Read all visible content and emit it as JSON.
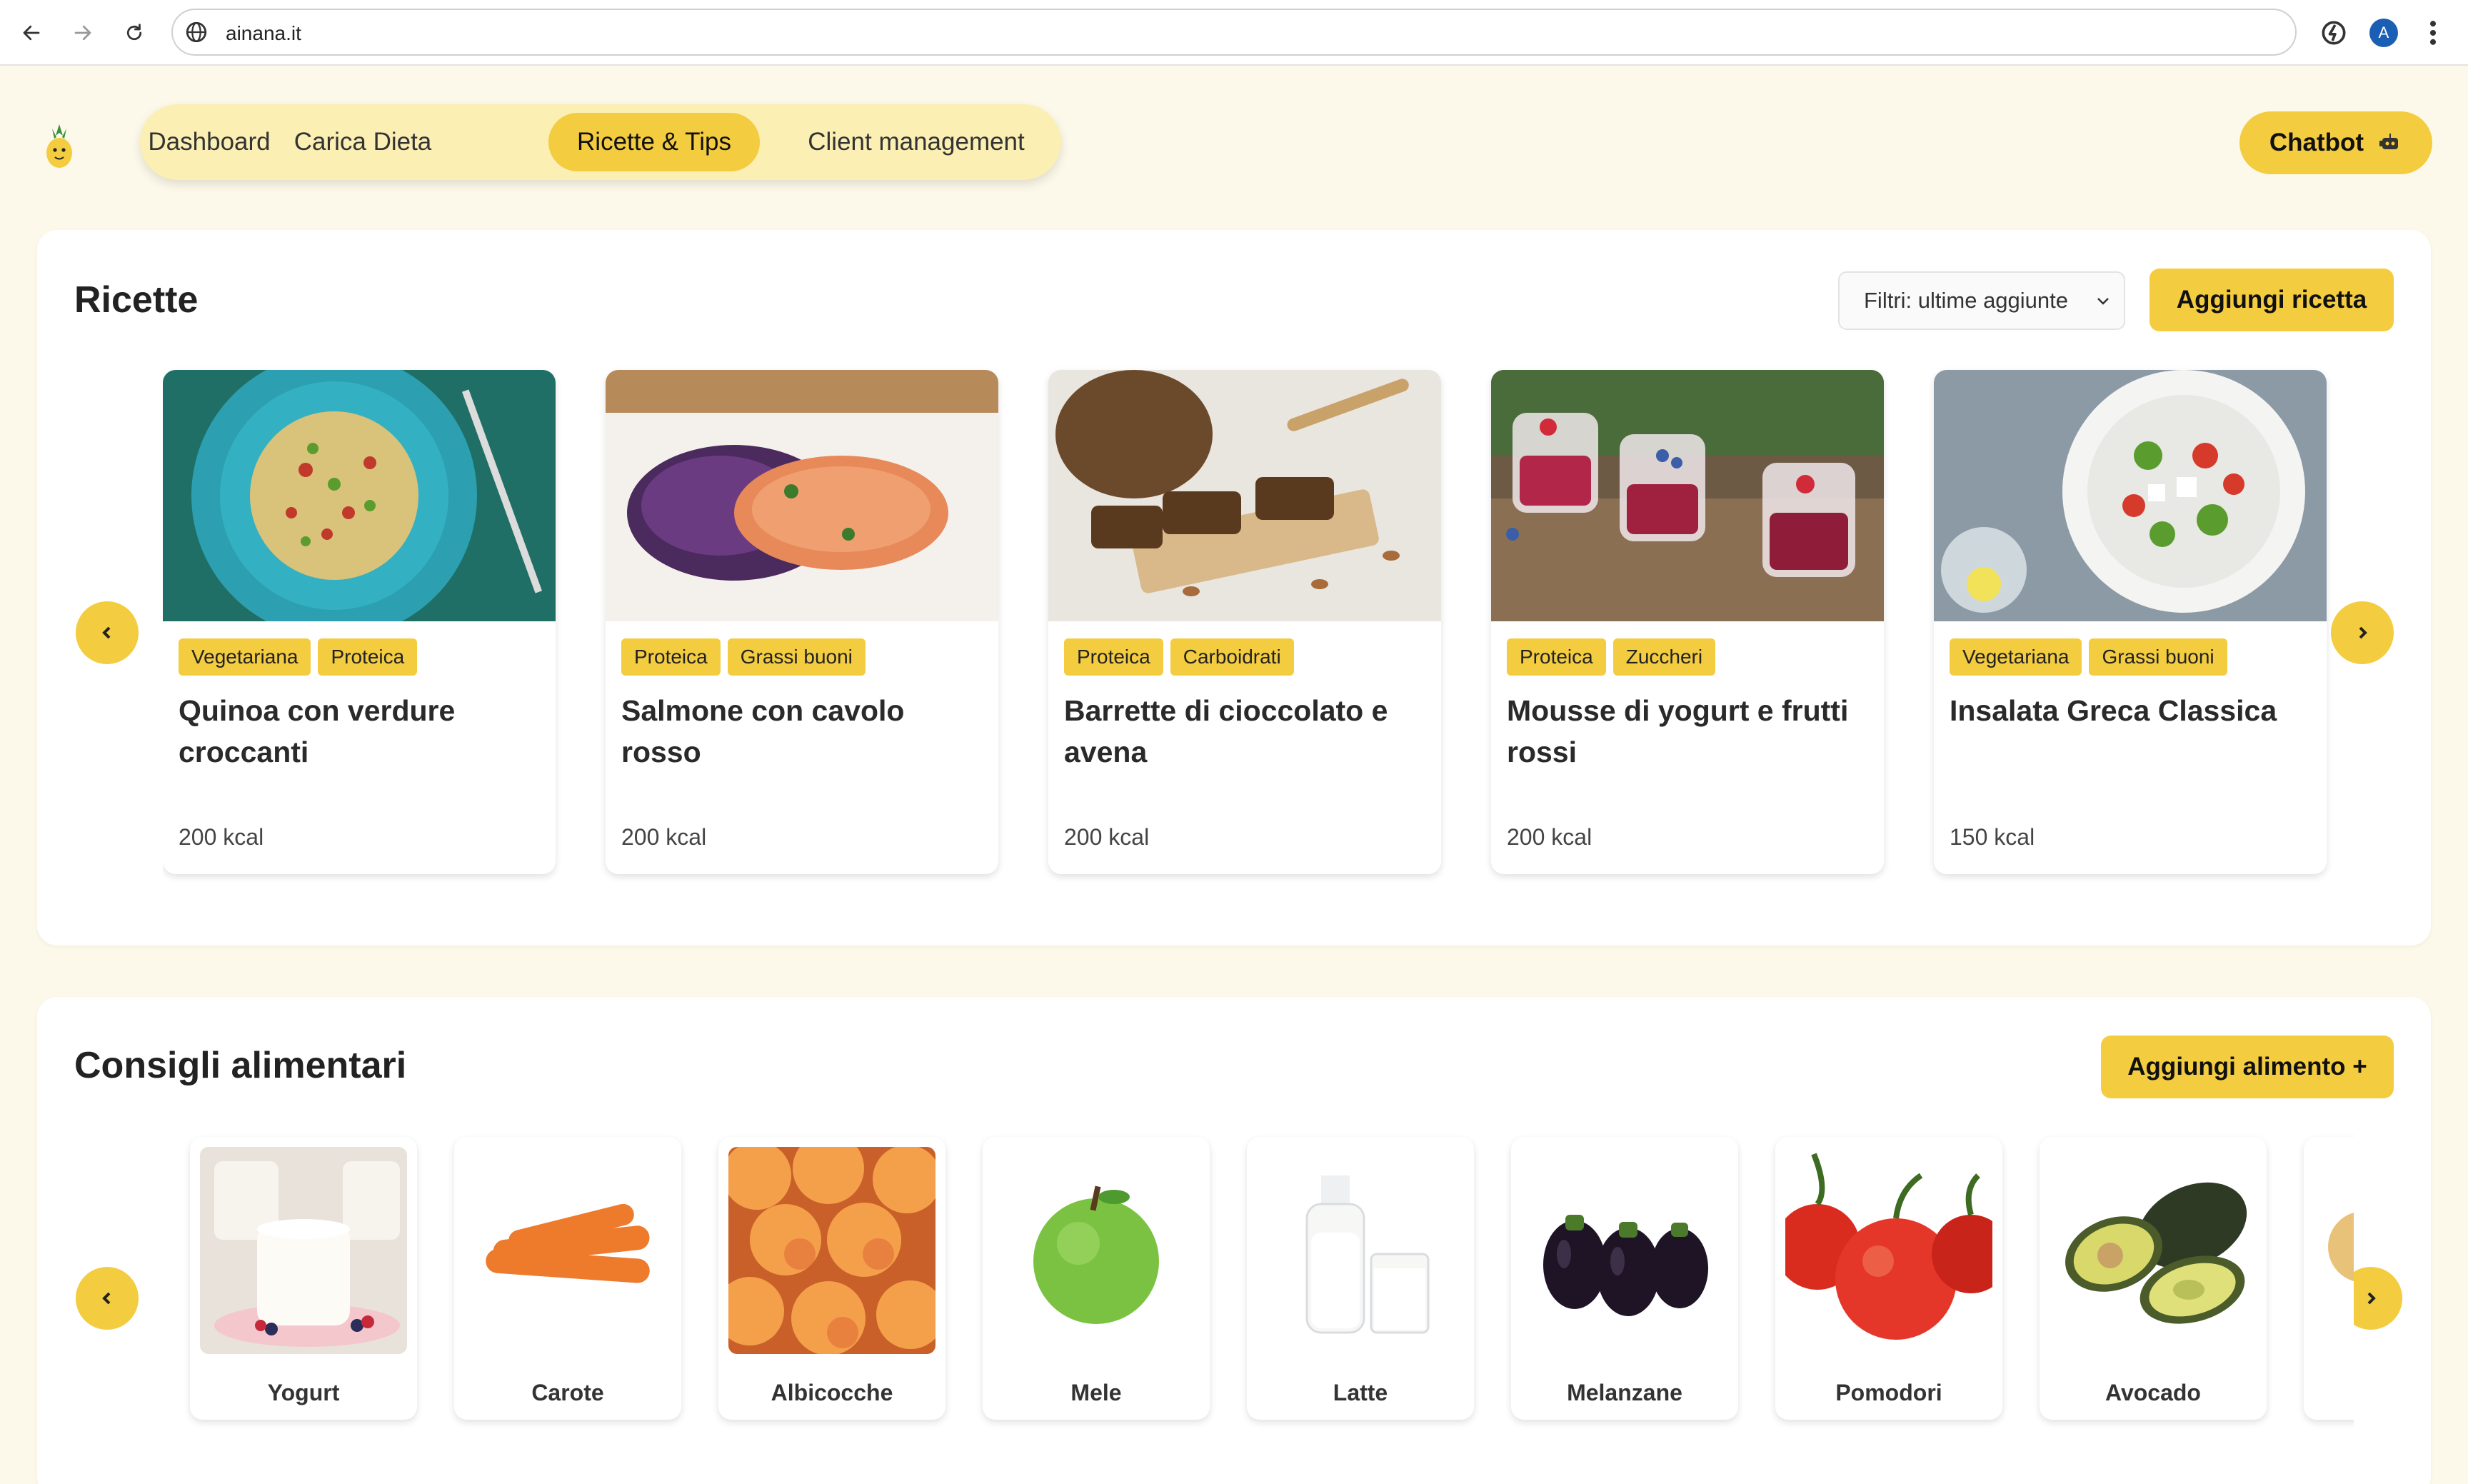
{
  "browser": {
    "url": "ainana.it",
    "profile_initial": "A"
  },
  "nav": {
    "tabs": [
      {
        "label": "Dashboard",
        "active": false
      },
      {
        "label": "Carica Dieta",
        "active": false
      },
      {
        "label": "Ricette & Tips",
        "active": true
      },
      {
        "label": "Client management",
        "active": false
      }
    ],
    "chatbot_label": "Chatbot"
  },
  "recipes": {
    "title": "Ricette",
    "filter_value": "Filtri: ultime aggiunte",
    "add_label": "Aggiungi ricetta",
    "items": [
      {
        "title": "Quinoa con verdure croccanti",
        "tags": [
          "Vegetariana",
          "Proteica"
        ],
        "kcal": "200 kcal",
        "image": "quinoa-plate"
      },
      {
        "title": "Salmone con cavolo rosso",
        "tags": [
          "Proteica",
          "Grassi buoni"
        ],
        "kcal": "200 kcal",
        "image": "salmon-plate"
      },
      {
        "title": "Barrette di cioccolato e avena",
        "tags": [
          "Proteica",
          "Carboidrati"
        ],
        "kcal": "200 kcal",
        "image": "granola-bars"
      },
      {
        "title": "Mousse di yogurt e frutti rossi",
        "tags": [
          "Proteica",
          "Zuccheri"
        ],
        "kcal": "200 kcal",
        "image": "berry-jars"
      },
      {
        "title": "Insalata Greca Classica",
        "tags": [
          "Vegetariana",
          "Grassi buoni"
        ],
        "kcal": "150 kcal",
        "image": "greek-salad"
      }
    ]
  },
  "foods": {
    "title": "Consigli alimentari",
    "add_label": "Aggiungi alimento +",
    "items": [
      {
        "name": "Yogurt",
        "image": "yogurt-jars"
      },
      {
        "name": "Carote",
        "image": "carrots"
      },
      {
        "name": "Albicocche",
        "image": "apricots"
      },
      {
        "name": "Mele",
        "image": "green-apple"
      },
      {
        "name": "Latte",
        "image": "milk-bottle"
      },
      {
        "name": "Melanzane",
        "image": "eggplants"
      },
      {
        "name": "Pomodori",
        "image": "tomatoes"
      },
      {
        "name": "Avocado",
        "image": "avocado"
      }
    ]
  },
  "colors": {
    "accent": "#f3cc40",
    "page_bg": "#fdf9ea",
    "nav_bg": "#fbefb3"
  }
}
